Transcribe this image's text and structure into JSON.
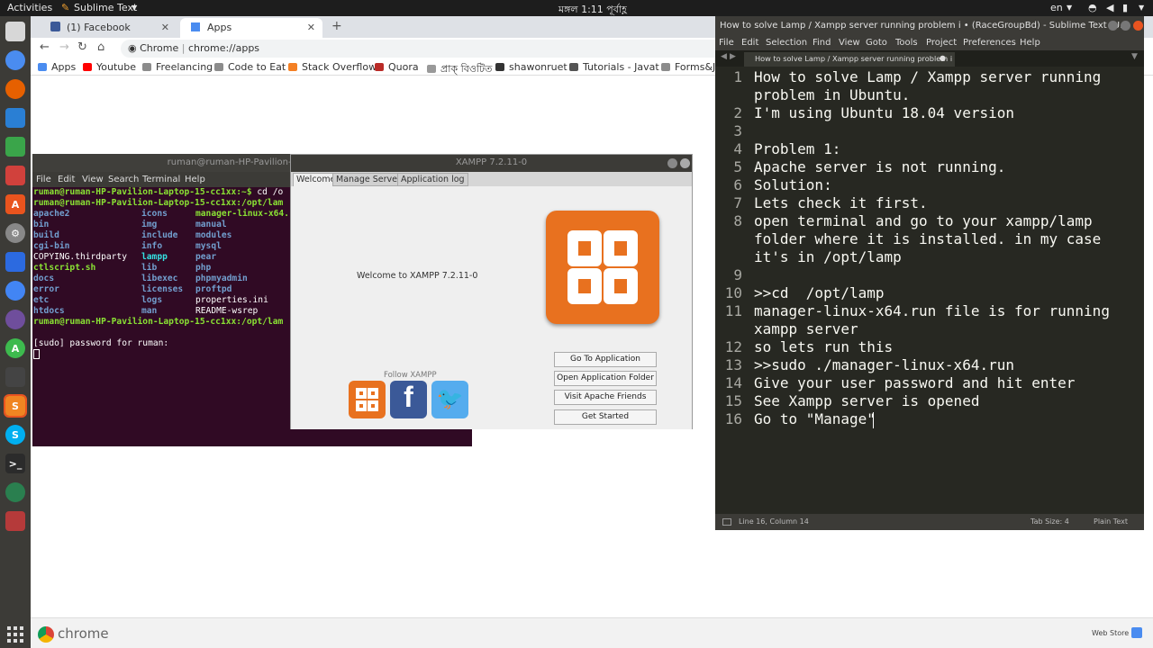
{
  "topbar": {
    "activities": "Activities",
    "app_name": "Sublime Text",
    "clock": "মঙ্গল  1:11 পূর্বাহ্ণ",
    "lang": "en"
  },
  "chrome": {
    "tabs": [
      {
        "label": "(1) Facebook"
      },
      {
        "label": "Apps"
      }
    ],
    "omnibox_prefix": "Chrome",
    "omnibox_url": "chrome://apps",
    "bookmarks": [
      "Apps",
      "Youtube",
      "Freelancing",
      "Code to Eat",
      "Stack Overflow",
      "Quora",
      "প্রাক্ বিওটিত",
      "shawonruet",
      "Tutorials - Javat",
      "Forms&J"
    ],
    "downloads_label": "chrome",
    "webstore_label": "Web Store"
  },
  "terminal": {
    "title": "ruman@ruman-HP-Pavilion-Laptop-15",
    "menu": [
      "File",
      "Edit",
      "View",
      "Search",
      "Terminal",
      "Help"
    ],
    "prompt1": "ruman@ruman-HP-Pavilion-Laptop-15-cc1xx:~$",
    "cmd1": " cd /o",
    "prompt2": "ruman@ruman-HP-Pavilion-Laptop-15-cc1xx:/opt/lam",
    "listing": [
      [
        "apache2",
        "icons",
        "manager-linux-x64."
      ],
      [
        "bin",
        "img",
        "manual"
      ],
      [
        "build",
        "include",
        "modules"
      ],
      [
        "cgi-bin",
        "info",
        "mysql"
      ],
      [
        "COPYING.thirdparty",
        "lampp",
        "pear"
      ],
      [
        "ctlscript.sh",
        "lib",
        "php"
      ],
      [
        "docs",
        "libexec",
        "phpmyadmin"
      ],
      [
        "error",
        "licenses",
        "proftpd"
      ],
      [
        "etc",
        "logs",
        "properties.ini"
      ],
      [
        "htdocs",
        "man",
        "README-wsrep"
      ]
    ],
    "prompt3": "ruman@ruman-HP-Pavilion-Laptop-15-cc1xx:/opt/lam",
    "sudo_line": "[sudo] password for ruman:"
  },
  "xampp": {
    "title": "XAMPP 7.2.11-0",
    "tabs": [
      "Welcome",
      "Manage Servers",
      "Application log"
    ],
    "welcome": "Welcome to XAMPP 7.2.11-0",
    "follow": "Follow  XAMPP",
    "buttons": [
      "Go To Application",
      "Open Application Folder",
      "Visit Apache Friends",
      "Get Started"
    ]
  },
  "sublime": {
    "title": "How to solve Lamp / Xampp server running problem i • (RaceGroupBd) - Sublime Text (U...",
    "menu": [
      "File",
      "Edit",
      "Selection",
      "Find",
      "View",
      "Goto",
      "Tools",
      "Project",
      "Preferences",
      "Help"
    ],
    "tab_label": "How to solve Lamp / Xampp server running problem i",
    "lines": [
      {
        "n": "1",
        "text": "How to solve Lamp / Xampp server running"
      },
      {
        "n": "",
        "text": "problem in Ubuntu."
      },
      {
        "n": "2",
        "text": "I'm using Ubuntu 18.04 version"
      },
      {
        "n": "3",
        "text": ""
      },
      {
        "n": "4",
        "text": "Problem 1:"
      },
      {
        "n": "5",
        "text": "Apache server is not running."
      },
      {
        "n": "6",
        "text": "Solution:"
      },
      {
        "n": "7",
        "text": "Lets check it first."
      },
      {
        "n": "8",
        "text": "open terminal and go to your xampp/lamp"
      },
      {
        "n": "",
        "text": "folder where it is installed. in my case"
      },
      {
        "n": "",
        "text": "it's in /opt/lamp"
      },
      {
        "n": "9",
        "text": ""
      },
      {
        "n": "10",
        "text": ">>cd  /opt/lamp"
      },
      {
        "n": "11",
        "text": "manager-linux-x64.run file is for running"
      },
      {
        "n": "",
        "text": "xampp server"
      },
      {
        "n": "12",
        "text": "so lets run this"
      },
      {
        "n": "13",
        "text": ">>sudo ./manager-linux-x64.run"
      },
      {
        "n": "14",
        "text": "Give your user password and hit enter"
      },
      {
        "n": "15",
        "text": "See Xampp server is opened"
      },
      {
        "n": "16",
        "text": "Go to \"Manage\""
      }
    ],
    "status_position": "Line 16, Column 14",
    "status_tabsize": "Tab Size: 4",
    "status_syntax": "Plain Text"
  }
}
